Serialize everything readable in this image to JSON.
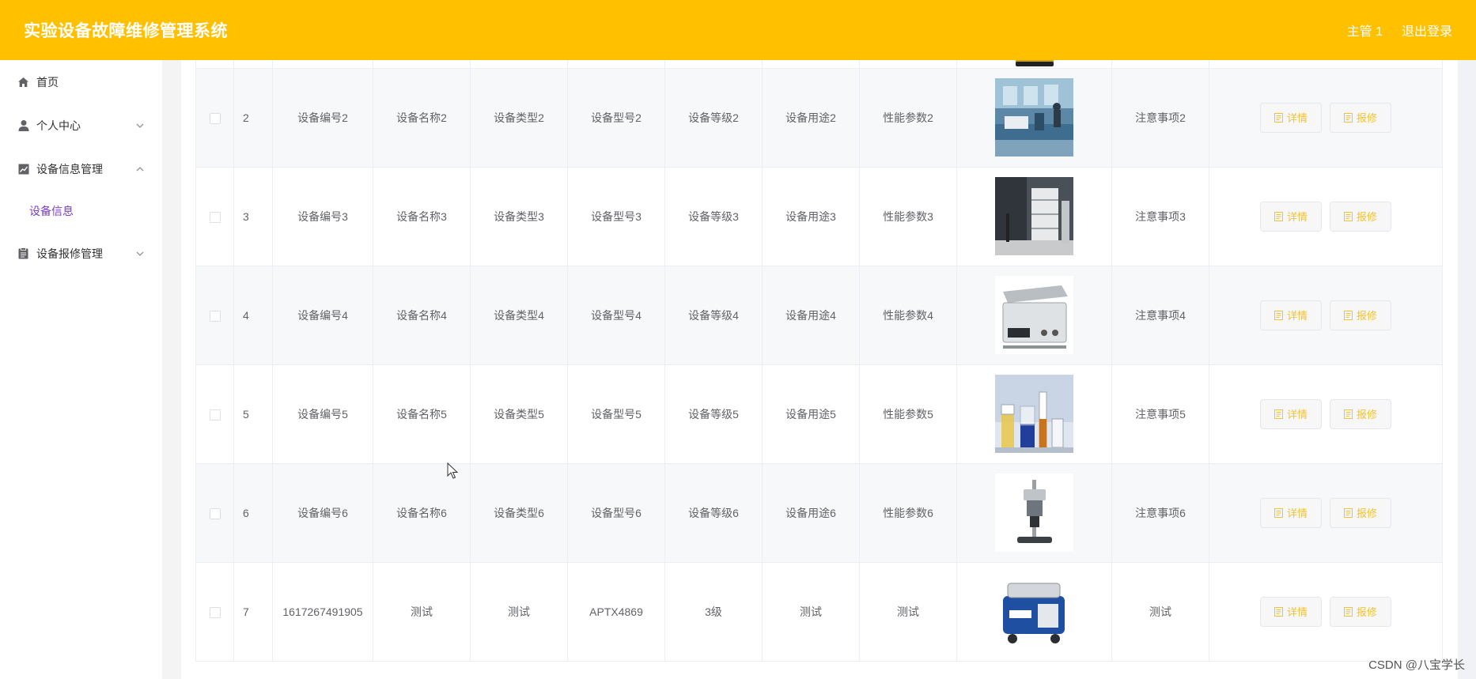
{
  "header": {
    "title": "实验设备故障维修管理系统",
    "user": "主管 1",
    "logout": "退出登录"
  },
  "sidebar": {
    "items": [
      {
        "label": "首页",
        "icon": "home-icon"
      },
      {
        "label": "个人中心",
        "icon": "person-icon"
      },
      {
        "label": "设备信息管理",
        "icon": "chart-icon"
      },
      {
        "label": "设备报修管理",
        "icon": "clipboard-icon"
      }
    ],
    "submenu": "设备信息"
  },
  "table": {
    "detail_label": "详情",
    "repair_label": "报修",
    "rows": [
      {
        "index": "2",
        "code": "设备编号2",
        "name": "设备名称2",
        "type": "设备类型2",
        "model": "设备型号2",
        "level": "设备等级2",
        "purpose": "设备用途2",
        "params": "性能参数2",
        "notes": "注意事项2"
      },
      {
        "index": "3",
        "code": "设备编号3",
        "name": "设备名称3",
        "type": "设备类型3",
        "model": "设备型号3",
        "level": "设备等级3",
        "purpose": "设备用途3",
        "params": "性能参数3",
        "notes": "注意事项3"
      },
      {
        "index": "4",
        "code": "设备编号4",
        "name": "设备名称4",
        "type": "设备类型4",
        "model": "设备型号4",
        "level": "设备等级4",
        "purpose": "设备用途4",
        "params": "性能参数4",
        "notes": "注意事项4"
      },
      {
        "index": "5",
        "code": "设备编号5",
        "name": "设备名称5",
        "type": "设备类型5",
        "model": "设备型号5",
        "level": "设备等级5",
        "purpose": "设备用途5",
        "params": "性能参数5",
        "notes": "注意事项5"
      },
      {
        "index": "6",
        "code": "设备编号6",
        "name": "设备名称6",
        "type": "设备类型6",
        "model": "设备型号6",
        "level": "设备等级6",
        "purpose": "设备用途6",
        "params": "性能参数6",
        "notes": "注意事项6"
      },
      {
        "index": "7",
        "code": "1617267491905",
        "name": "测试",
        "type": "测试",
        "model": "APTX4869",
        "level": "3级",
        "purpose": "测试",
        "params": "测试",
        "notes": "测试"
      }
    ]
  },
  "watermark": "CSDN @八宝学长",
  "colors": {
    "header_bg": "#ffc000",
    "accent": "#f1c232",
    "submenu_active": "#7b3fc4",
    "stripe": "#f7f8fa"
  }
}
